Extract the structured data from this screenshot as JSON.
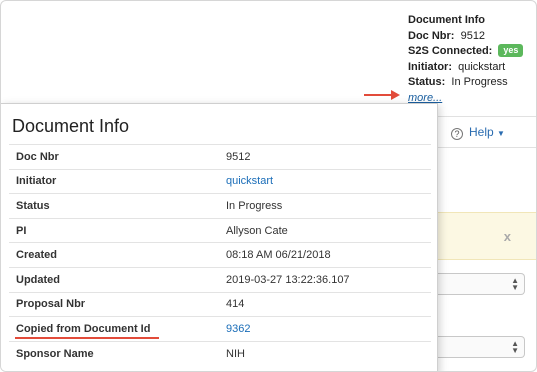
{
  "top_info": {
    "title": "Document Info",
    "doc_nbr_label": "Doc Nbr:",
    "doc_nbr_value": "9512",
    "s2s_label": "S2S Connected:",
    "s2s_badge": "yes",
    "initiator_label": "Initiator:",
    "initiator_value": "quickstart",
    "status_label": "Status:",
    "status_value": "In Progress",
    "more_link": "more..."
  },
  "help": {
    "label": "Help",
    "icon": "question-circle-icon"
  },
  "alert": {
    "close": "x"
  },
  "popup": {
    "title": "Document Info",
    "rows": [
      {
        "label": "Doc Nbr",
        "value": "9512"
      },
      {
        "label": "Initiator",
        "value": "quickstart"
      },
      {
        "label": "Status",
        "value": "In Progress"
      },
      {
        "label": "PI",
        "value": "Allyson Cate"
      },
      {
        "label": "Created",
        "value": "08:18 AM 06/21/2018"
      },
      {
        "label": "Updated",
        "value": "2019-03-27 13:22:36.107"
      },
      {
        "label": "Proposal Nbr",
        "value": "414"
      },
      {
        "label": "Copied from Document Id",
        "value": "9362"
      },
      {
        "label": "Sponsor Name",
        "value": "NIH"
      }
    ]
  },
  "colors": {
    "accent_link": "#1a6db8",
    "badge_green": "#5cb85c",
    "arrow_red": "#e24b3a",
    "alert_bg": "#fcf8e3"
  }
}
